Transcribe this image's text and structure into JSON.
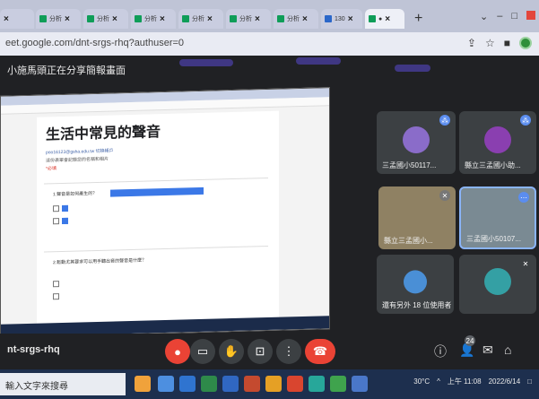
{
  "browser": {
    "tabs": [
      {
        "label": "×"
      },
      {
        "label": "分析"
      },
      {
        "label": "分析"
      },
      {
        "label": "分析"
      },
      {
        "label": "分析"
      },
      {
        "label": "分析"
      },
      {
        "label": "分析"
      },
      {
        "label": "分析"
      },
      {
        "label": "130"
      },
      {
        "label": "●"
      }
    ],
    "url": "eet.google.com/dnt-srgs-rhq?authuser=0",
    "new_tab": "+"
  },
  "meet": {
    "presenting_banner": "小施馬頭正在分享簡報畫面",
    "meeting_code": "nt-srgs-rhq",
    "participant_count": "24"
  },
  "shared_form": {
    "title": "生活中常見的聲音",
    "account": "poo16123@gsha.edu.tw 切換帳戶",
    "note": "這份表單會記錄您的名稱和相片",
    "required": "*必填",
    "q1": "1.聲音是如何產生的？",
    "q2": "2.鬆動尤其要求可以用手聽出音的聲音是什麼？"
  },
  "participants": [
    {
      "name": "三孟國小50117..."
    },
    {
      "name": "縣立三孟國小助..."
    },
    {
      "name": "縣立三孟國小..."
    },
    {
      "name": "三孟國小50107..."
    },
    {
      "name": "還有另外 18 位使用者"
    }
  ],
  "taskbar": {
    "search_placeholder": "輸入文字來搜尋",
    "weather": "30°C",
    "time": "上午 11:08",
    "date": "2022/6/14"
  }
}
